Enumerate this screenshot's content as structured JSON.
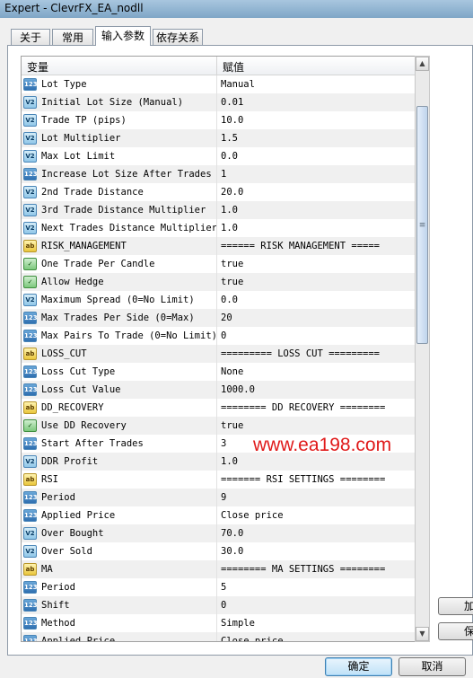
{
  "window": {
    "title": "Expert - ClevrFX_EA_nodll"
  },
  "tabs": [
    {
      "label": "关于",
      "active": false
    },
    {
      "label": "常用",
      "active": false
    },
    {
      "label": "输入参数",
      "active": true
    },
    {
      "label": "依存关系",
      "active": false
    }
  ],
  "table": {
    "headers": {
      "variable": "变量",
      "value": "赋值"
    },
    "rows": [
      {
        "icon": "int",
        "name": "Lot Type",
        "value": "Manual"
      },
      {
        "icon": "double",
        "name": "Initial Lot Size (Manual)",
        "value": "0.01"
      },
      {
        "icon": "double",
        "name": "Trade TP (pips)",
        "value": "10.0"
      },
      {
        "icon": "double",
        "name": "Lot Multiplier",
        "value": "1.5"
      },
      {
        "icon": "double",
        "name": "Max Lot Limit",
        "value": "0.0"
      },
      {
        "icon": "int",
        "name": "Increase Lot Size After Trades",
        "value": "1"
      },
      {
        "icon": "double",
        "name": "2nd Trade Distance",
        "value": "20.0"
      },
      {
        "icon": "double",
        "name": "3rd Trade Distance Multiplier",
        "value": "1.0"
      },
      {
        "icon": "double",
        "name": "Next Trades Distance Multiplier",
        "value": "1.0"
      },
      {
        "icon": "string",
        "name": "RISK_MANAGEMENT",
        "value": "====== RISK MANAGEMENT ====="
      },
      {
        "icon": "bool",
        "name": "One Trade Per Candle",
        "value": "true"
      },
      {
        "icon": "bool",
        "name": "Allow Hedge",
        "value": "true"
      },
      {
        "icon": "double",
        "name": "Maximum Spread (0=No Limit)",
        "value": "0.0"
      },
      {
        "icon": "int",
        "name": "Max Trades Per Side (0=Max)",
        "value": "20"
      },
      {
        "icon": "int",
        "name": "Max Pairs To Trade (0=No Limit)",
        "value": "0"
      },
      {
        "icon": "string",
        "name": "LOSS_CUT",
        "value": "========= LOSS CUT ========="
      },
      {
        "icon": "int",
        "name": "Loss Cut Type",
        "value": "None"
      },
      {
        "icon": "int",
        "name": "Loss Cut Value",
        "value": "1000.0"
      },
      {
        "icon": "string",
        "name": "DD_RECOVERY",
        "value": "======== DD RECOVERY ========"
      },
      {
        "icon": "bool",
        "name": "Use DD Recovery",
        "value": "true"
      },
      {
        "icon": "int",
        "name": "Start After Trades",
        "value": "3"
      },
      {
        "icon": "double",
        "name": "DDR Profit",
        "value": "1.0"
      },
      {
        "icon": "string",
        "name": "RSI",
        "value": "======= RSI SETTINGS ========"
      },
      {
        "icon": "int",
        "name": "Period",
        "value": "9"
      },
      {
        "icon": "int",
        "name": "Applied Price",
        "value": "Close price"
      },
      {
        "icon": "double",
        "name": "Over Bought",
        "value": "70.0"
      },
      {
        "icon": "double",
        "name": "Over Sold",
        "value": "30.0"
      },
      {
        "icon": "string",
        "name": "MA",
        "value": "======== MA SETTINGS ========"
      },
      {
        "icon": "int",
        "name": "Period",
        "value": "5"
      },
      {
        "icon": "int",
        "name": "Shift",
        "value": "0"
      },
      {
        "icon": "int",
        "name": "Method",
        "value": "Simple"
      },
      {
        "icon": "int",
        "name": "Applied Price",
        "value": "Close price"
      }
    ]
  },
  "icon_glyphs": {
    "int": "123",
    "double": "V2",
    "string": "ab",
    "bool": "✓"
  },
  "side_buttons": {
    "load": "加",
    "save": "保"
  },
  "buttons": {
    "ok": "确定",
    "cancel": "取消"
  },
  "watermark": "www.ea198.com"
}
